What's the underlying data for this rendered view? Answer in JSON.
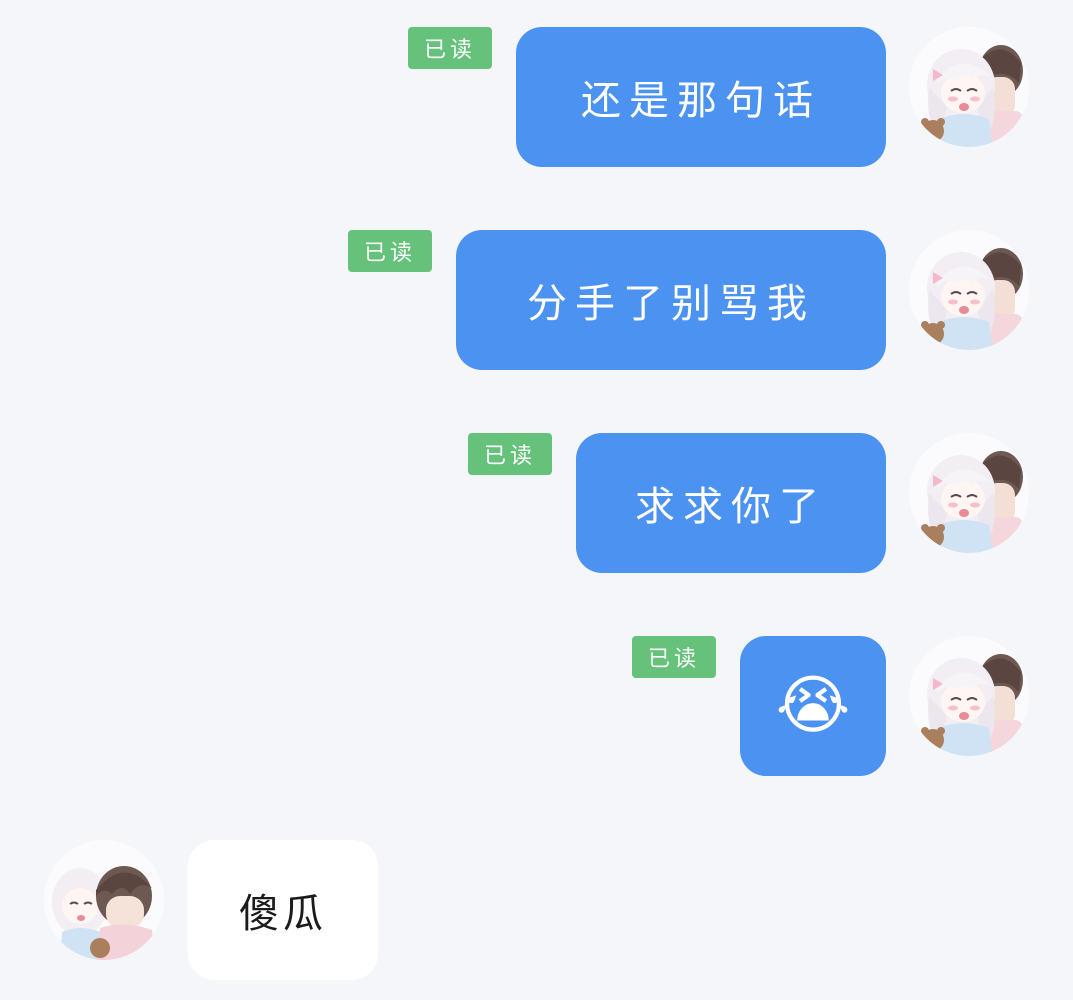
{
  "messages": [
    {
      "text": "还是那句话",
      "status": "已读"
    },
    {
      "text": "分手了别骂我",
      "status": "已读"
    },
    {
      "text": "求求你了",
      "status": "已读"
    },
    {
      "text": "😭",
      "status": "已读"
    }
  ],
  "reply": {
    "text": "傻瓜"
  },
  "colors": {
    "background": "#f4f6f9",
    "outgoing_bubble": "#4b92f1",
    "incoming_bubble": "#ffffff",
    "read_badge": "#66c27a"
  },
  "icons": {
    "self_avatar": "anime-avatar-girl-boy",
    "other_avatar": "anime-avatar-boy-girl"
  }
}
